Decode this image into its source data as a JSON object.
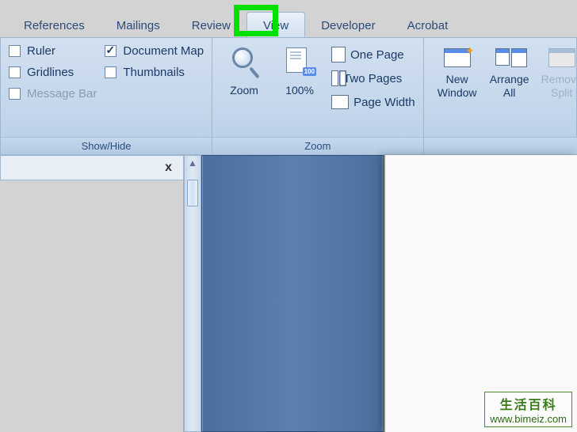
{
  "tabs": {
    "references": "References",
    "mailings": "Mailings",
    "review": "Review",
    "view": "View",
    "developer": "Developer",
    "acrobat": "Acrobat"
  },
  "ribbon": {
    "showhide": {
      "title": "Show/Hide",
      "ruler": "Ruler",
      "gridlines": "Gridlines",
      "messagebar": "Message Bar",
      "documentmap": "Document Map",
      "thumbnails": "Thumbnails",
      "checked": {
        "ruler": false,
        "gridlines": false,
        "messagebar": false,
        "documentmap": true,
        "thumbnails": false
      }
    },
    "zoom": {
      "title": "Zoom",
      "zoom": "Zoom",
      "hundred": "100%",
      "onepage": "One Page",
      "twopages": "Two Pages",
      "pagewidth": "Page Width"
    },
    "window": {
      "new": "New\nWindow",
      "arrange": "Arrange\nAll",
      "remove": "Remove\nSplit"
    }
  },
  "docmap": {
    "close": "x"
  },
  "watermark": {
    "top": "生活百科",
    "url": "www.bimeiz.com"
  },
  "highlighted_tab": "view"
}
